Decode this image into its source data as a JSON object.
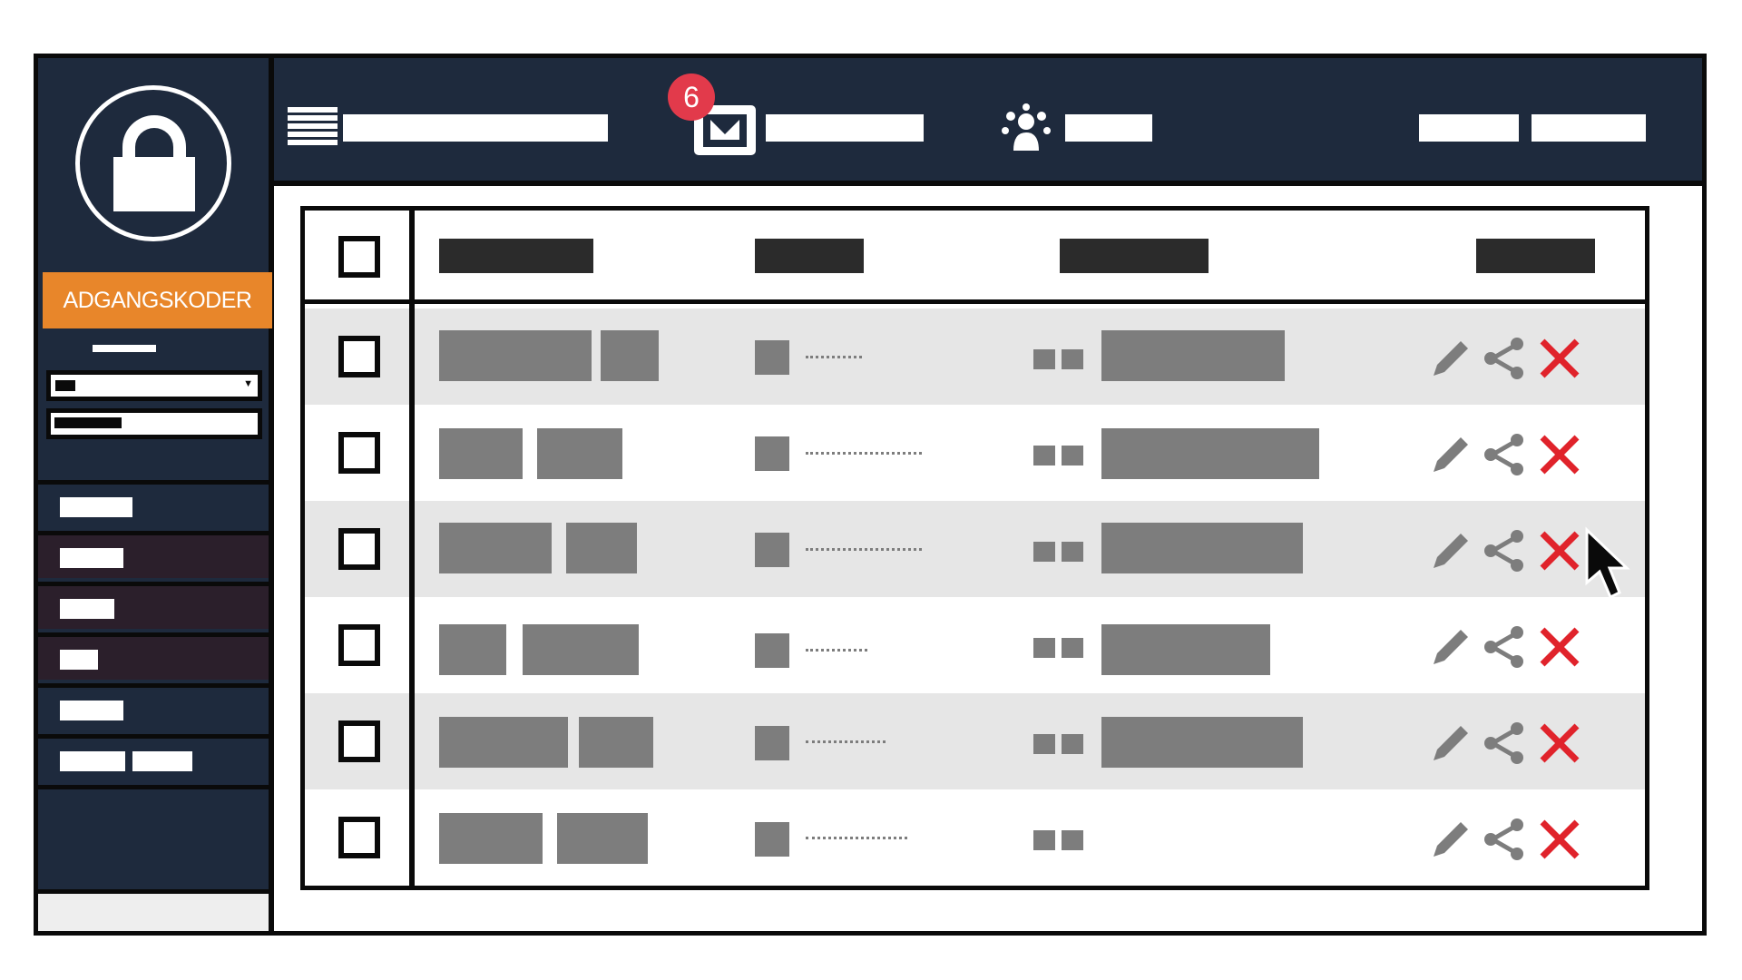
{
  "sidebar": {
    "app_title": "ADGANGSKODER",
    "logo_icon": "lock-icon"
  },
  "header": {
    "icons": [
      "list-icon",
      "mail-icon",
      "people-icon"
    ],
    "unread_count": "6"
  },
  "table": {
    "rows": 6,
    "row_actions": [
      "pencil-icon",
      "share-icon",
      "close-icon"
    ]
  },
  "colors": {
    "sidebar_bg": "#1e2a3d",
    "accent": "#e8862a",
    "badge": "#e23a4b",
    "delete": "#e0232b",
    "placeholder": "#7d7d7d"
  }
}
